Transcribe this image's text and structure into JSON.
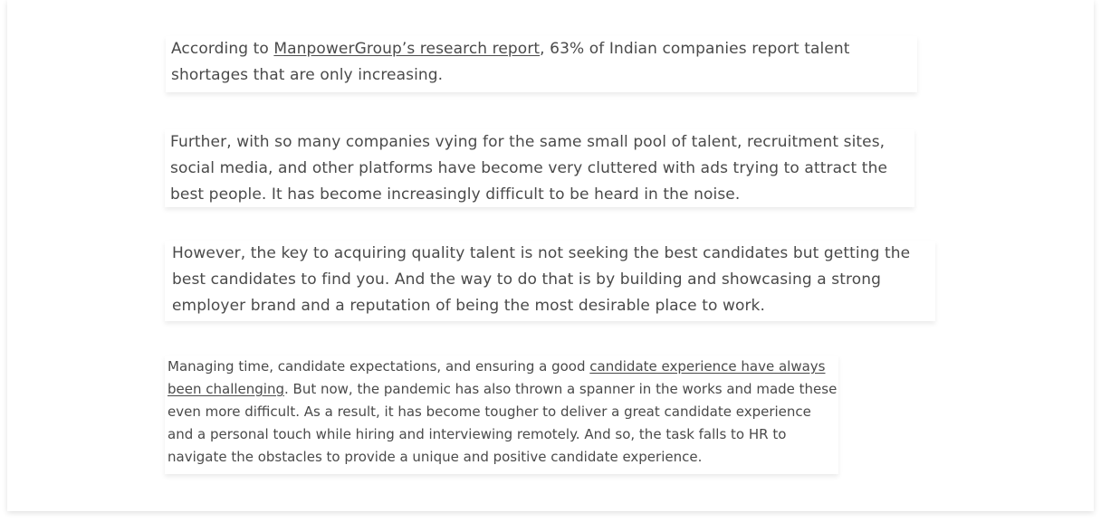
{
  "article": {
    "p1": {
      "before": "According to ",
      "link": "ManpowerGroup’s research report",
      "after": ", 63% of Indian companies report talent shortages that are only increasing."
    },
    "p2": {
      "text": "Further, with so many companies vying for the same small pool of talent, recruitment sites, social media, and other platforms have become very cluttered with ads trying to attract the best people. It has become increasingly difficult to be heard in the noise."
    },
    "p3": {
      "text": "However, the key to acquiring quality talent is not seeking the best candidates but getting the best candidates to find you. And the way to do that is by building and showcasing a strong employer brand and a reputation of being the most desirable place to work."
    },
    "p4": {
      "before": "Managing time, candidate expectations, and ensuring a good ",
      "link": "candidate experience have always been challenging",
      "after": ". But now, the pandemic has also thrown a spanner in the works and made these even more difficult. As a result, it has become tougher to deliver a great candidate experience and a personal touch while hiring and interviewing remotely. And so, the task falls to HR to navigate the obstacles to provide a unique and positive candidate experience."
    }
  }
}
